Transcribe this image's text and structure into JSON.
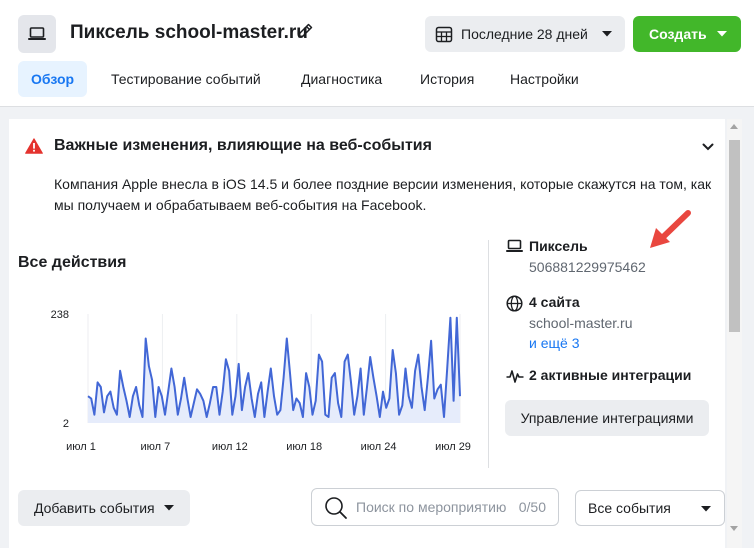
{
  "header": {
    "title": "Пиксель school-master.ru",
    "date_range": "Последние 28 дней",
    "create_label": "Создать",
    "accent_color": "#42b72a"
  },
  "tabs": [
    {
      "label": "Обзор",
      "active": true
    },
    {
      "label": "Тестирование событий",
      "active": false
    },
    {
      "label": "Диагностика",
      "active": false
    },
    {
      "label": "История",
      "active": false
    },
    {
      "label": "Настройки",
      "active": false
    }
  ],
  "alert": {
    "title": "Важные изменения, влияющие на веб-события",
    "text": "Компания Apple внесла в iOS 14.5 и более поздние версии изменения, которые скажутся на том, как мы получаем и обрабатываем веб-события на Facebook.",
    "icon": "warning-icon",
    "color": "#e4332e"
  },
  "activity": {
    "title": "Все действия"
  },
  "chart_data": {
    "type": "line",
    "y_ticks": [
      "238",
      "2"
    ],
    "ylim": [
      2,
      238
    ],
    "x_ticks": [
      "июл 1",
      "июл 7",
      "июл 12",
      "июл 18",
      "июл 24",
      "июл 29"
    ],
    "line_color": "#4267d6",
    "series": [
      {
        "values": [
          60,
          55,
          20,
          90,
          80,
          25,
          60,
          70,
          35,
          20,
          115,
          80,
          50,
          15,
          60,
          80,
          40,
          15,
          185,
          125,
          95,
          15,
          80,
          60,
          20,
          70,
          120,
          80,
          20,
          55,
          100,
          55,
          15,
          45,
          75,
          65,
          50,
          15,
          45,
          80,
          80,
          20,
          70,
          140,
          115,
          20,
          60,
          130,
          30,
          80,
          110,
          55,
          15,
          65,
          90,
          15,
          70,
          120,
          60,
          20,
          30,
          100,
          185,
          110,
          30,
          55,
          45,
          15,
          110,
          80,
          20,
          50,
          150,
          135,
          20,
          15,
          100,
          110,
          45,
          15,
          135,
          150,
          90,
          20,
          60,
          120,
          20,
          80,
          145,
          100,
          60,
          15,
          70,
          35,
          55,
          160,
          110,
          20,
          40,
          120,
          60,
          35,
          115,
          150,
          80,
          30,
          100,
          180,
          55,
          75,
          85,
          15,
          120,
          230,
          50,
          230,
          60
        ]
      }
    ]
  },
  "info": {
    "pixel_label": "Пиксель",
    "pixel_id": "506881229975462",
    "sites_label": "4 сайта",
    "site_name": "school-master.ru",
    "more_link": "и ещё 3",
    "integrations_label": "2 активные интеграции",
    "manage_button": "Управление интеграциями"
  },
  "footer": {
    "add_events": "Добавить события",
    "search_placeholder": "Поиск по мероприятию",
    "search_count": "0/50",
    "events_filter": "Все события"
  }
}
